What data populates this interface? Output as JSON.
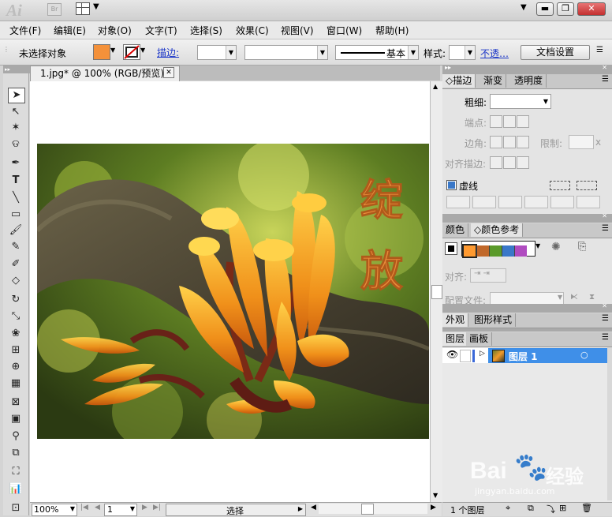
{
  "app": {
    "logo": "Ai",
    "bridge": "Br",
    "window_buttons": {
      "minimize": "▬",
      "restore": "❐",
      "close": "✕"
    }
  },
  "menu": [
    "文件(F)",
    "编辑(E)",
    "对象(O)",
    "文字(T)",
    "选择(S)",
    "效果(C)",
    "视图(V)",
    "窗口(W)",
    "帮助(H)"
  ],
  "control": {
    "selection_status": "未选择对象",
    "stroke_label": "描边",
    "stroke_profile": "基本",
    "style_label": "样式",
    "opacity_link": "不透…",
    "doc_setup_button": "文档设置",
    "fill_color": "#f4913a"
  },
  "document": {
    "tab_title": "1.jpg* @ 100% (RGB/预览)",
    "canvas_text": [
      "绽",
      "放"
    ]
  },
  "status": {
    "zoom": "100%",
    "page": "1",
    "mode": "选择"
  },
  "panels": {
    "stroke": {
      "tabs": [
        "描边",
        "渐变",
        "透明度"
      ],
      "weight_label": "粗细",
      "cap_label": "端点",
      "corner_label": "边角",
      "limit_label": "限制",
      "limit_value": "x",
      "align_label": "对齐描边",
      "dashed_label": "虚线"
    },
    "color": {
      "tabs": [
        "颜色",
        "颜色参考"
      ],
      "swatches": [
        "#ff9a30",
        "#c0682a",
        "#5a9a2a",
        "#3a78c8",
        "#b04cc0"
      ],
      "align_label": "对齐",
      "profile_label": "配置文件"
    },
    "appearance": {
      "tabs": [
        "外观",
        "图形样式"
      ]
    },
    "layers": {
      "tabs": [
        "图层",
        "画板"
      ],
      "rows": [
        {
          "name": "图层 1",
          "color": "#3a68d8"
        }
      ],
      "footer": "1 个图层"
    }
  },
  "watermark": {
    "brand": "Bai",
    "brand_suffix": "经验",
    "url": "jingyan.baidu.com"
  }
}
